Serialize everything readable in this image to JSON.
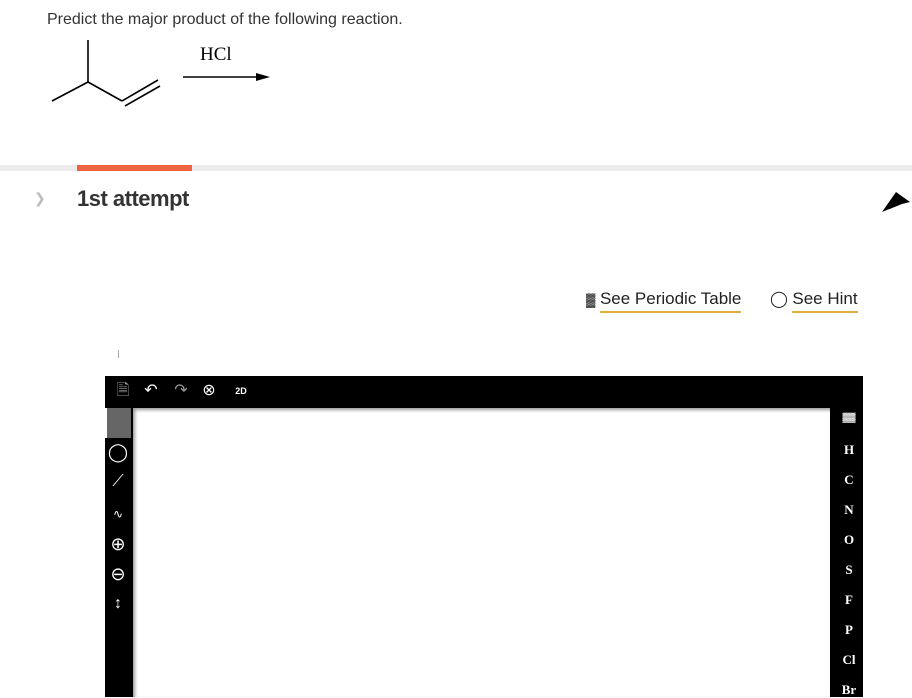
{
  "question": {
    "text": "Predict the major product of the following reaction.",
    "reagent": "HCl"
  },
  "attempt": {
    "label": "1st attempt",
    "progress_color": "#ee6443"
  },
  "links": {
    "periodic_table": "See Periodic Table",
    "hint": "See Hint"
  },
  "editor": {
    "top_tools": [
      "new-document",
      "undo",
      "redo",
      "zoom-clear",
      "2d-clean"
    ],
    "two_d_label": "2D",
    "left_tools": [
      "select",
      "eraser",
      "single-bond",
      "chain",
      "positive-charge",
      "negative-charge",
      "reaction-arrow"
    ],
    "elements": [
      "H",
      "C",
      "N",
      "O",
      "S",
      "F",
      "P",
      "Cl",
      "Br"
    ]
  }
}
